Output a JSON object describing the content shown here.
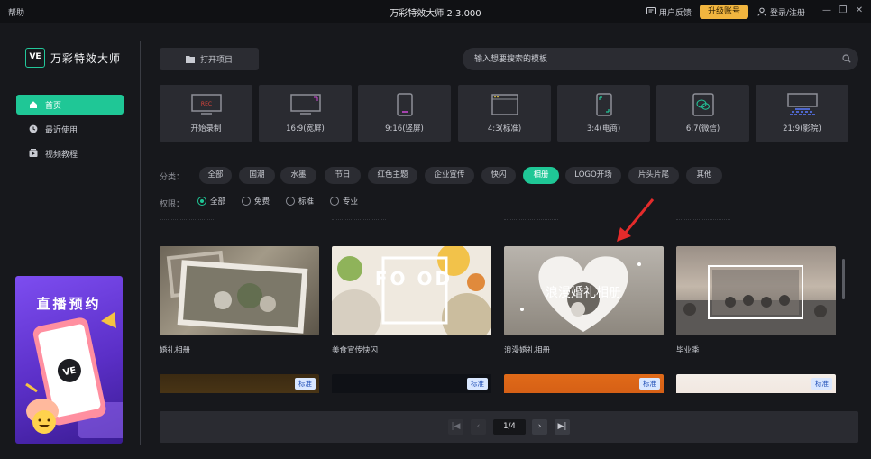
{
  "titlebar": {
    "help": "帮助",
    "title": "万彩特效大师 2.3.000",
    "feedback": "用户反馈",
    "upgrade": "升级账号",
    "login": "登录/注册",
    "min_glyph": "—",
    "restore_glyph": "❐",
    "close_glyph": "✕"
  },
  "logo": {
    "mark": "VE",
    "name": "万彩特效大师"
  },
  "sidebar": {
    "items": [
      {
        "label": "首页",
        "icon": "home-icon",
        "active": true
      },
      {
        "label": "最近使用",
        "icon": "clock-icon",
        "active": false
      },
      {
        "label": "视频教程",
        "icon": "video-tutorial-icon",
        "active": false
      }
    ],
    "promo": {
      "title": "直播预约",
      "mark": "VE"
    }
  },
  "toolbar": {
    "open_project": "打开项目",
    "search_placeholder": "输入想要搜索的模板"
  },
  "ratios": [
    {
      "label": "开始录制",
      "icon": "record-icon",
      "badge": "REC"
    },
    {
      "label": "16:9(宽屏)",
      "icon": "widescreen-icon"
    },
    {
      "label": "9:16(竖屏)",
      "icon": "portrait-phone-icon"
    },
    {
      "label": "4:3(标准)",
      "icon": "standard-window-icon"
    },
    {
      "label": "3:4(电商)",
      "icon": "ecommerce-phone-icon"
    },
    {
      "label": "6:7(微信)",
      "icon": "wechat-icon"
    },
    {
      "label": "21:9(影院)",
      "icon": "cinema-icon"
    }
  ],
  "filters": {
    "category_label": "分类：",
    "categories": [
      {
        "label": "全部",
        "active": false
      },
      {
        "label": "国潮",
        "active": false
      },
      {
        "label": "水墨",
        "active": false
      },
      {
        "label": "节日",
        "active": false
      },
      {
        "label": "红色主题",
        "active": false
      },
      {
        "label": "企业宣传",
        "active": false
      },
      {
        "label": "快闪",
        "active": false
      },
      {
        "label": "相册",
        "active": true
      },
      {
        "label": "LOGO开场",
        "active": false
      },
      {
        "label": "片头片尾",
        "active": false
      },
      {
        "label": "其他",
        "active": false
      }
    ],
    "permission_label": "权限：",
    "permissions": [
      {
        "label": "全部",
        "active": true
      },
      {
        "label": "免费",
        "active": false
      },
      {
        "label": "标准",
        "active": false
      },
      {
        "label": "专业",
        "active": false
      }
    ]
  },
  "templates": [
    {
      "label": "婚礼相册"
    },
    {
      "label": "美食宣传快闪",
      "overlay": "FO OD"
    },
    {
      "label": "浪漫婚礼相册",
      "overlay": "浪漫婚礼相册"
    },
    {
      "label": "毕业季"
    }
  ],
  "templates_next_row": [
    {
      "badge": "标准"
    },
    {
      "badge": "标准"
    },
    {
      "badge": "标准"
    },
    {
      "badge": "标准"
    }
  ],
  "pagination": {
    "first_glyph": "|◀",
    "prev_glyph": "‹",
    "page": "1/4",
    "next_glyph": "›",
    "last_glyph": "▶|"
  }
}
